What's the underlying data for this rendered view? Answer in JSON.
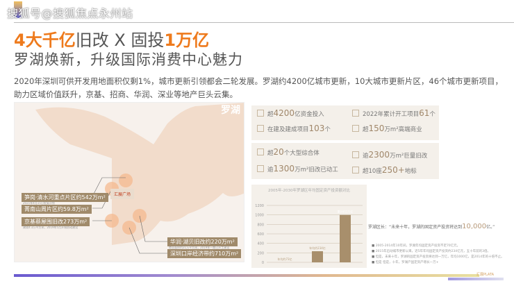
{
  "watermark": "搜狐号@搜狐焦点永州站",
  "title": {
    "p1": "4大千亿",
    "p2": "旧改 X 固投",
    "p3": "1万亿"
  },
  "subtitle": "罗湖焕新，升级国际消费中心魅力",
  "paragraph": "2020年深圳可供开发用地面积仅剩1%，城市更新引领都会二轮发展。罗湖约4200亿城市更新，10大城市更新片区，46个城市更新项目，助力区域价值跃升，京基、招商、华润、深业等地产巨头云集。",
  "map": {
    "district": "罗湖",
    "center_label": "汇展广场",
    "labels": [
      {
        "text": "笋岗·清水河重点片区约542万m²",
        "note": "2021年4月15日批复计划"
      },
      {
        "text": "菁南山周片区约59.8万m²"
      },
      {
        "text": "京基蔡屋围旧改273万m²",
        "note": "建成4.3万平方米，2019年5月开始启动建设"
      },
      {
        "text": "华润·湖贝旧改约220万m²",
        "note": "商业面积约21万平方米，2019年一期已开工建设"
      },
      {
        "text": "深圳口岸经济带约710万m²"
      }
    ]
  },
  "stats": [
    {
      "icon": "coins-icon",
      "pre": "超",
      "num": "4200",
      "post": "亿资金投入"
    },
    {
      "icon": "buildings-icon",
      "pre": "2022年累计开工项目",
      "num": "61",
      "post": "个"
    },
    {
      "icon": "buildings-icon",
      "pre": "在建及建成项目",
      "num": "103",
      "post": "个"
    },
    {
      "icon": "shop-icon",
      "pre": "超",
      "num": "150",
      "post": "万m²高端商业"
    },
    {
      "icon": "complex-icon",
      "pre": "超",
      "num": "20",
      "post": "个大型综合体"
    },
    {
      "icon": "crane-icon",
      "pre": "逾",
      "num": "2300",
      "post": "万m²巨量旧改"
    },
    {
      "icon": "crane-icon",
      "pre": "逾",
      "num": "1300",
      "post": "万m²旧改已动工"
    },
    {
      "icon": "tower-icon",
      "pre": "超10座",
      "num": "250+",
      "post": "地标"
    }
  ],
  "chart_data": {
    "type": "bar",
    "title": "2005年-2030年罗湖区年均固定资产投资额对比",
    "categories": [
      "2005-2014年均",
      "2015-2019年均",
      "未来十年累计"
    ],
    "values": [
      73,
      234,
      1000
    ],
    "data_labels": [
      "年均约73亿",
      "年均约234亿",
      "累计约1万亿"
    ],
    "ylim": [
      0,
      1200
    ],
    "yticks": [
      0,
      200,
      400,
      600,
      800,
      1000,
      1200
    ],
    "bar_color": "#a88f6c"
  },
  "quote": {
    "text": "罗湖区长：“未来十年，罗湖的固定资产投资将达到",
    "num": "10,000",
    "suffix": "亿。”"
  },
  "bullets": [
    "2005-2014年10年间，罗湖年均固定资产投资不足70亿元。",
    "2015年启动城市更新以来，近5年年均固定资产投资约234亿元，五十年前的3倍。",
    "但是，未来十年，罗湖的固定资产投资将达到一万亿，年均1000亿，是2014年的十倍不止。",
    "但是 但是，十年，罗湖产固定资产增长一万+"
  ],
  "brand": "汇展PLATA"
}
